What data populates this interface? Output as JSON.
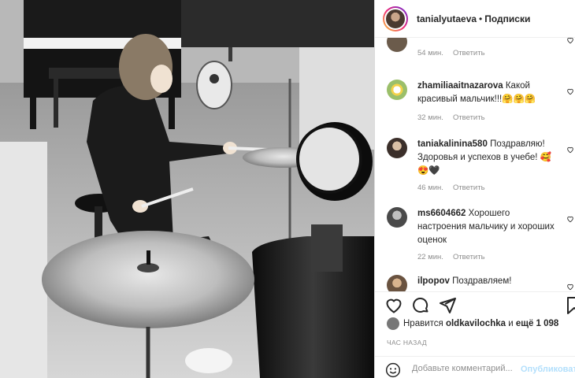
{
  "post": {
    "username": "tanialyutaeva",
    "separator": "•",
    "follow_label": "Подписки",
    "more_icon": "more-horizontal-icon"
  },
  "comments": [
    {
      "username": "",
      "text": "",
      "time": "54 мин.",
      "reply": "Ответить"
    },
    {
      "username": "zhamiliaaitnazarova",
      "text": "Какой красивый мальчик!!!🤗🤗🤗",
      "time": "32 мин.",
      "reply": "Ответить"
    },
    {
      "username": "taniakalinina580",
      "text": "Поздравляю! Здоровья и успехов в учебе! 🥰 😍🖤",
      "time": "46 мин.",
      "reply": "Ответить"
    },
    {
      "username": "ms6604662",
      "text": "Хорошего настроения мальчику и хороших оценок",
      "time": "22 мин.",
      "reply": "Ответить"
    },
    {
      "username": "ilpopov",
      "text": "Поздравляем!",
      "time": "",
      "reply": ""
    }
  ],
  "actions": {
    "like_icon": "heart-icon",
    "comment_icon": "comment-icon",
    "share_icon": "share-icon",
    "save_icon": "bookmark-icon"
  },
  "likes": {
    "prefix": "Нравится",
    "user": "oldkavilochka",
    "and": "и",
    "count": "ещё 1 098"
  },
  "time_ago": "ЧАС НАЗАД",
  "add_comment": {
    "placeholder": "Добавьте комментарий...",
    "publish_label": "Опубликовать",
    "emoji_icon": "emoji-icon"
  }
}
